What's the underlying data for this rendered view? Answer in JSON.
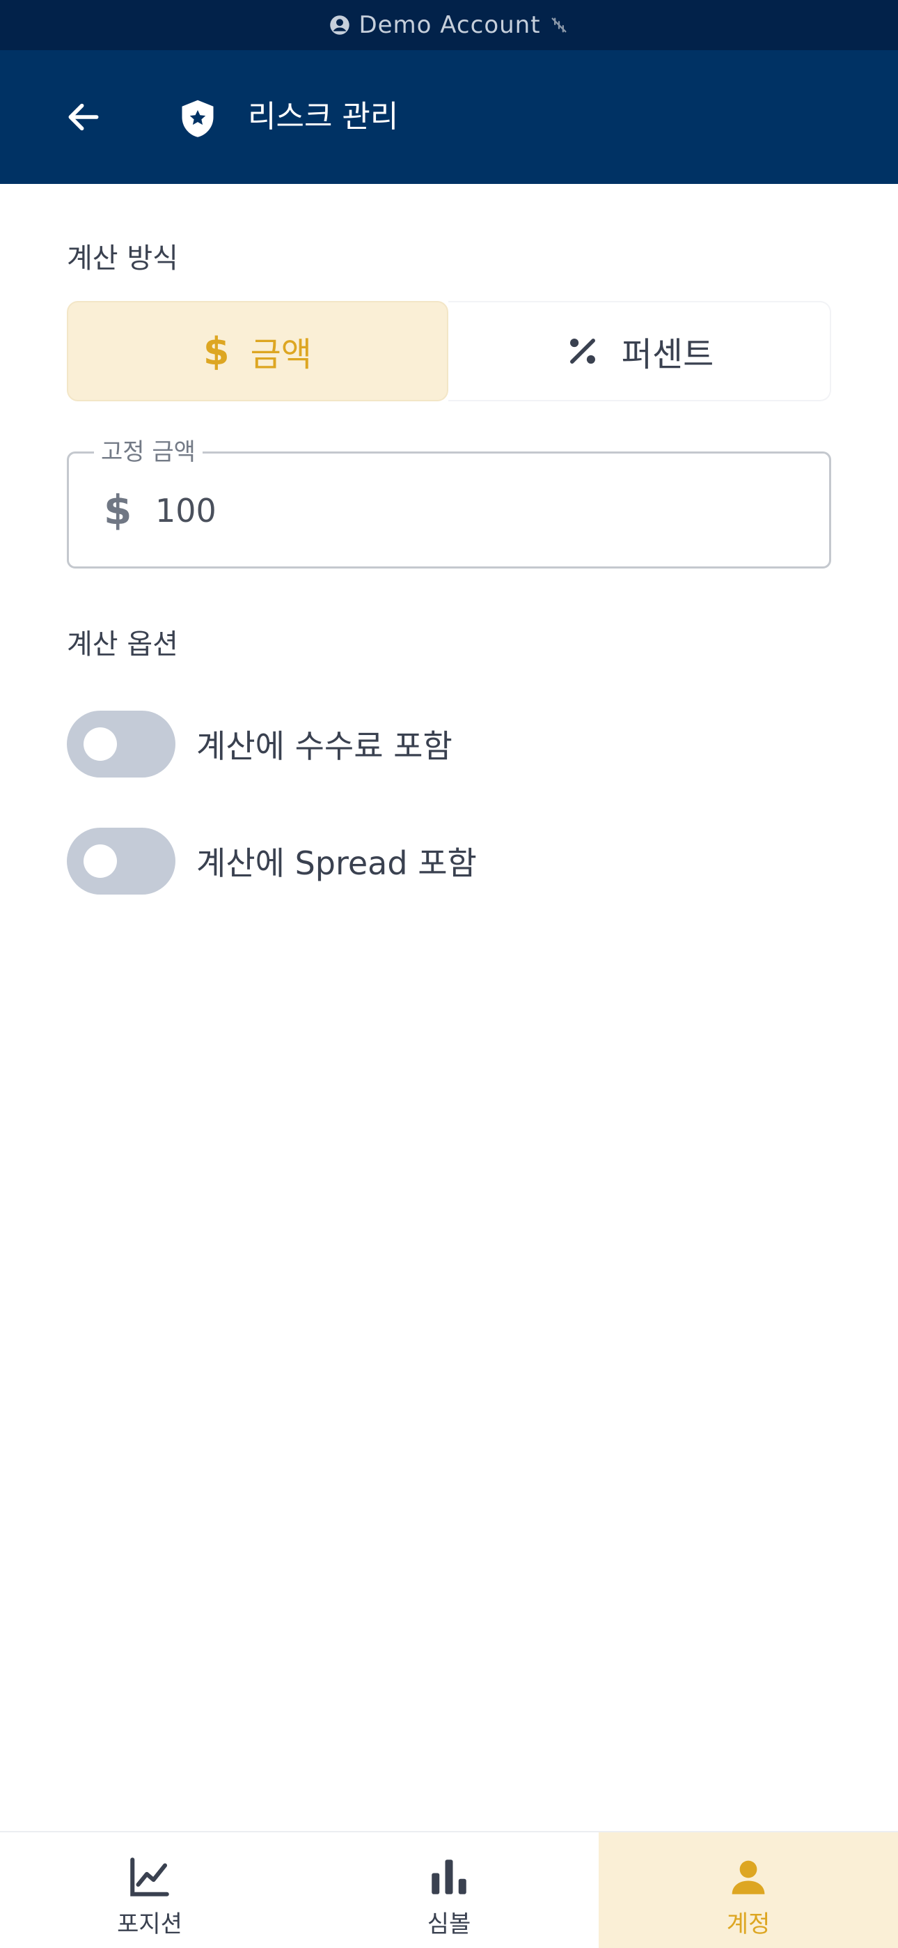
{
  "status_bar": {
    "account_text": "Demo Account",
    "icons": [
      "account-circle-icon",
      "no-connection-icon"
    ]
  },
  "header": {
    "title": "리스크 관리",
    "icons": [
      "arrow-back-icon",
      "shield-star-icon"
    ]
  },
  "calc_method": {
    "label": "계산 방식",
    "options": [
      {
        "label": "금액",
        "icon": "dollar-icon",
        "selected": true
      },
      {
        "label": "퍼센트",
        "icon": "percent-icon",
        "selected": false
      }
    ]
  },
  "amount_field": {
    "legend": "고정 금액",
    "prefix": "$",
    "value": "100"
  },
  "calc_options": {
    "label": "계산 옵션",
    "toggles": [
      {
        "label": "계산에 수수료 포함",
        "on": false
      },
      {
        "label": "계산에 Spread 포함",
        "on": false
      }
    ]
  },
  "bottom_nav": [
    {
      "label": "포지션",
      "icon": "line-chart-icon",
      "active": false
    },
    {
      "label": "심볼",
      "icon": "bar-chart-icon",
      "active": false
    },
    {
      "label": "계정",
      "icon": "person-icon",
      "active": true
    }
  ],
  "colors": {
    "header_bg": "#003264",
    "status_bg": "#02224a",
    "accent": "#dda622",
    "accent_bg": "#faefd6",
    "toggle_off": "#c4cbd7"
  }
}
